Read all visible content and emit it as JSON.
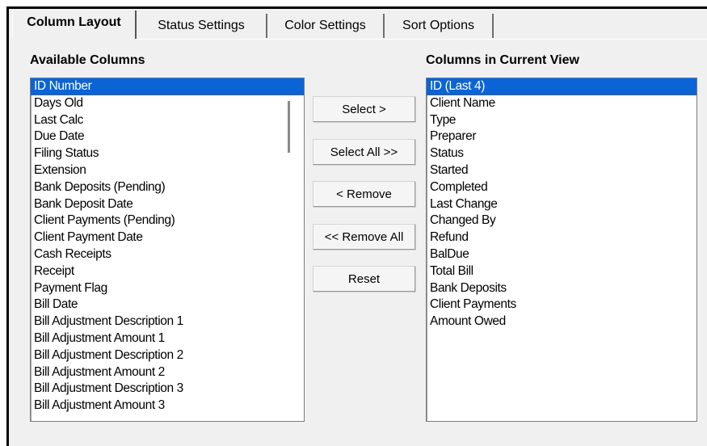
{
  "tabs": [
    {
      "label": "Column Layout",
      "active": true
    },
    {
      "label": "Status Settings",
      "active": false
    },
    {
      "label": "Color Settings",
      "active": false
    },
    {
      "label": "Sort Options",
      "active": false
    }
  ],
  "available": {
    "heading": "Available Columns",
    "items": [
      "ID Number",
      "Days Old",
      "Last Calc",
      "Due Date",
      "Filing Status",
      "Extension",
      "Bank Deposits (Pending)",
      "Bank Deposit Date",
      "Client Payments (Pending)",
      "Client Payment Date",
      "Cash Receipts",
      "Receipt",
      "Payment Flag",
      "Bill Date",
      "Bill Adjustment Description 1",
      "Bill Adjustment Amount 1",
      "Bill Adjustment Description 2",
      "Bill Adjustment Amount 2",
      "Bill Adjustment Description 3",
      "Bill Adjustment Amount 3"
    ],
    "selected_index": 0
  },
  "current": {
    "heading": "Columns in Current View",
    "items": [
      "ID (Last 4)",
      "Client Name",
      "Type",
      "Preparer",
      "Status",
      "Started",
      "Completed",
      "Last Change",
      "Changed By",
      "Refund",
      "BalDue",
      "Total Bill",
      "Bank Deposits",
      "Client Payments",
      "Amount Owed"
    ],
    "selected_index": 0
  },
  "buttons": {
    "select": "Select >",
    "select_all": "Select All >>",
    "remove": "< Remove",
    "remove_all": "<< Remove All",
    "reset": "Reset"
  },
  "colors": {
    "selection": "#0a64d6",
    "panel": "#f0f0f0"
  }
}
